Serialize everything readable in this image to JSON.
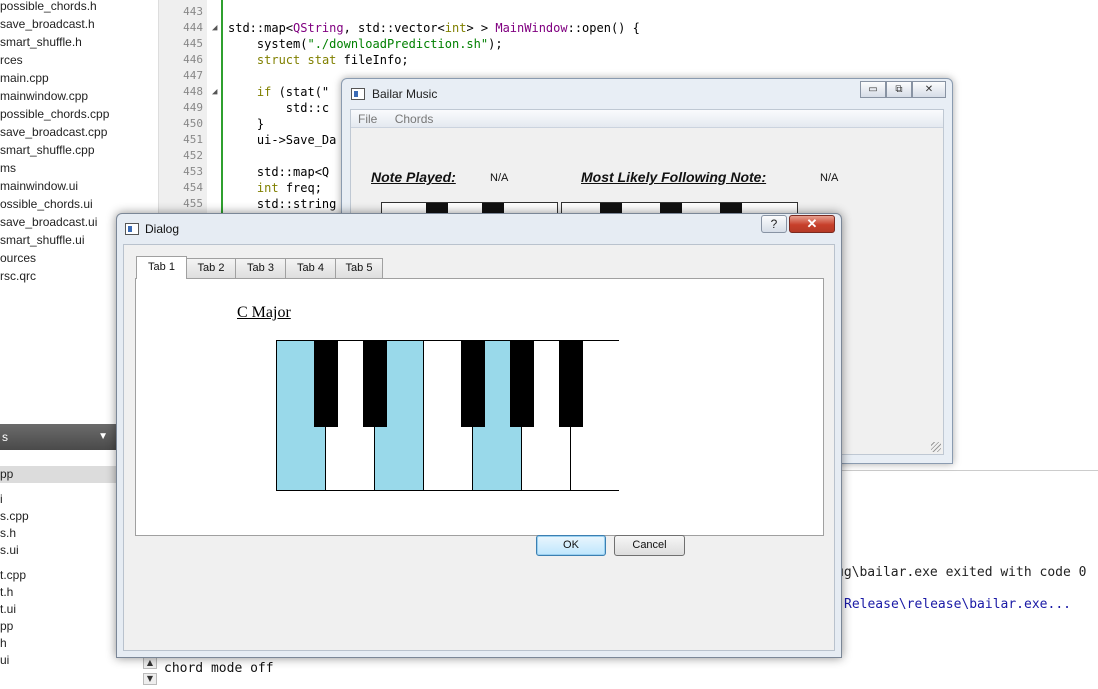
{
  "file_tree": {
    "items": [
      "possible_chords.h",
      "save_broadcast.h",
      "smart_shuffle.h",
      "rces",
      "main.cpp",
      "mainwindow.cpp",
      "possible_chords.cpp",
      "save_broadcast.cpp",
      "smart_shuffle.cpp",
      "ms",
      "mainwindow.ui",
      "ossible_chords.ui",
      "save_broadcast.ui",
      "smart_shuffle.ui",
      "ources",
      "rsc.qrc"
    ]
  },
  "secondary_panel": {
    "header": "s",
    "items": [
      "pp",
      "",
      "i",
      "s.cpp",
      "s.h",
      "s.ui",
      "",
      "t.cpp",
      "t.h",
      "t.ui",
      "pp",
      "h",
      "ui"
    ]
  },
  "editor": {
    "lines": [
      {
        "num": "443",
        "fold": "",
        "segments": [
          {
            "t": "",
            "c": ""
          }
        ]
      },
      {
        "num": "444",
        "fold": "◢",
        "segments": [
          {
            "t": "std::map<",
            "c": ""
          },
          {
            "t": "QString",
            "c": "ty"
          },
          {
            "t": ", std::vector<",
            "c": ""
          },
          {
            "t": "int",
            "c": "kw"
          },
          {
            "t": "> > ",
            "c": ""
          },
          {
            "t": "MainWindow",
            "c": "ty"
          },
          {
            "t": "::open() {",
            "c": ""
          }
        ]
      },
      {
        "num": "445",
        "fold": "",
        "segments": [
          {
            "t": "    system(",
            "c": ""
          },
          {
            "t": "\"./downloadPrediction.sh\"",
            "c": "str"
          },
          {
            "t": ");",
            "c": ""
          }
        ]
      },
      {
        "num": "446",
        "fold": "",
        "segments": [
          {
            "t": "    ",
            "c": ""
          },
          {
            "t": "struct",
            "c": "kw"
          },
          {
            "t": " ",
            "c": ""
          },
          {
            "t": "stat",
            "c": "kw"
          },
          {
            "t": " fileInfo;",
            "c": ""
          }
        ]
      },
      {
        "num": "447",
        "fold": "",
        "segments": [
          {
            "t": "",
            "c": ""
          }
        ]
      },
      {
        "num": "448",
        "fold": "◢",
        "segments": [
          {
            "t": "    ",
            "c": ""
          },
          {
            "t": "if",
            "c": "kw"
          },
          {
            "t": " (stat(\"",
            "c": ""
          }
        ]
      },
      {
        "num": "449",
        "fold": "",
        "segments": [
          {
            "t": "        std::c",
            "c": ""
          }
        ]
      },
      {
        "num": "450",
        "fold": "",
        "segments": [
          {
            "t": "    }",
            "c": ""
          }
        ]
      },
      {
        "num": "451",
        "fold": "",
        "segments": [
          {
            "t": "    ui->Save_Da",
            "c": ""
          }
        ]
      },
      {
        "num": "452",
        "fold": "",
        "segments": [
          {
            "t": "",
            "c": ""
          }
        ]
      },
      {
        "num": "453",
        "fold": "",
        "segments": [
          {
            "t": "    std::map<Q",
            "c": ""
          }
        ]
      },
      {
        "num": "454",
        "fold": "",
        "segments": [
          {
            "t": "    ",
            "c": ""
          },
          {
            "t": "int",
            "c": "kw"
          },
          {
            "t": " freq;",
            "c": ""
          }
        ]
      },
      {
        "num": "455",
        "fold": "",
        "segments": [
          {
            "t": "    std::string",
            "c": ""
          }
        ]
      }
    ]
  },
  "output": {
    "line_exited": "ug\\bailar.exe exited with code 0",
    "line_release": "Release\\release\\bailar.exe...",
    "line_chord_mode": "chord mode off"
  },
  "bailar_window": {
    "title": "Bailar Music",
    "menu": [
      "File",
      "Chords"
    ],
    "note_played_label": "Note Played:",
    "note_played_value": "N/A",
    "following_label": "Most Likely Following Note:",
    "following_value": "N/A",
    "icon": "window-icon",
    "buttons": {
      "minimize": "▭",
      "maximize": "⧉",
      "close": "✕"
    }
  },
  "dialog": {
    "title": "Dialog",
    "icon": "window-icon",
    "help_label": "?",
    "close_label": "✕",
    "tabs": [
      "Tab 1",
      "Tab 2",
      "Tab 3",
      "Tab 4",
      "Tab 5"
    ],
    "active_tab": 0,
    "chord_name": "C Major",
    "piano": {
      "white_keys": [
        "C",
        "D",
        "E",
        "F",
        "G",
        "A",
        "B"
      ],
      "highlighted_white_keys": [
        "C",
        "E",
        "G"
      ],
      "highlight_color": "#99d9ea"
    },
    "ok_label": "OK",
    "cancel_label": "Cancel"
  }
}
